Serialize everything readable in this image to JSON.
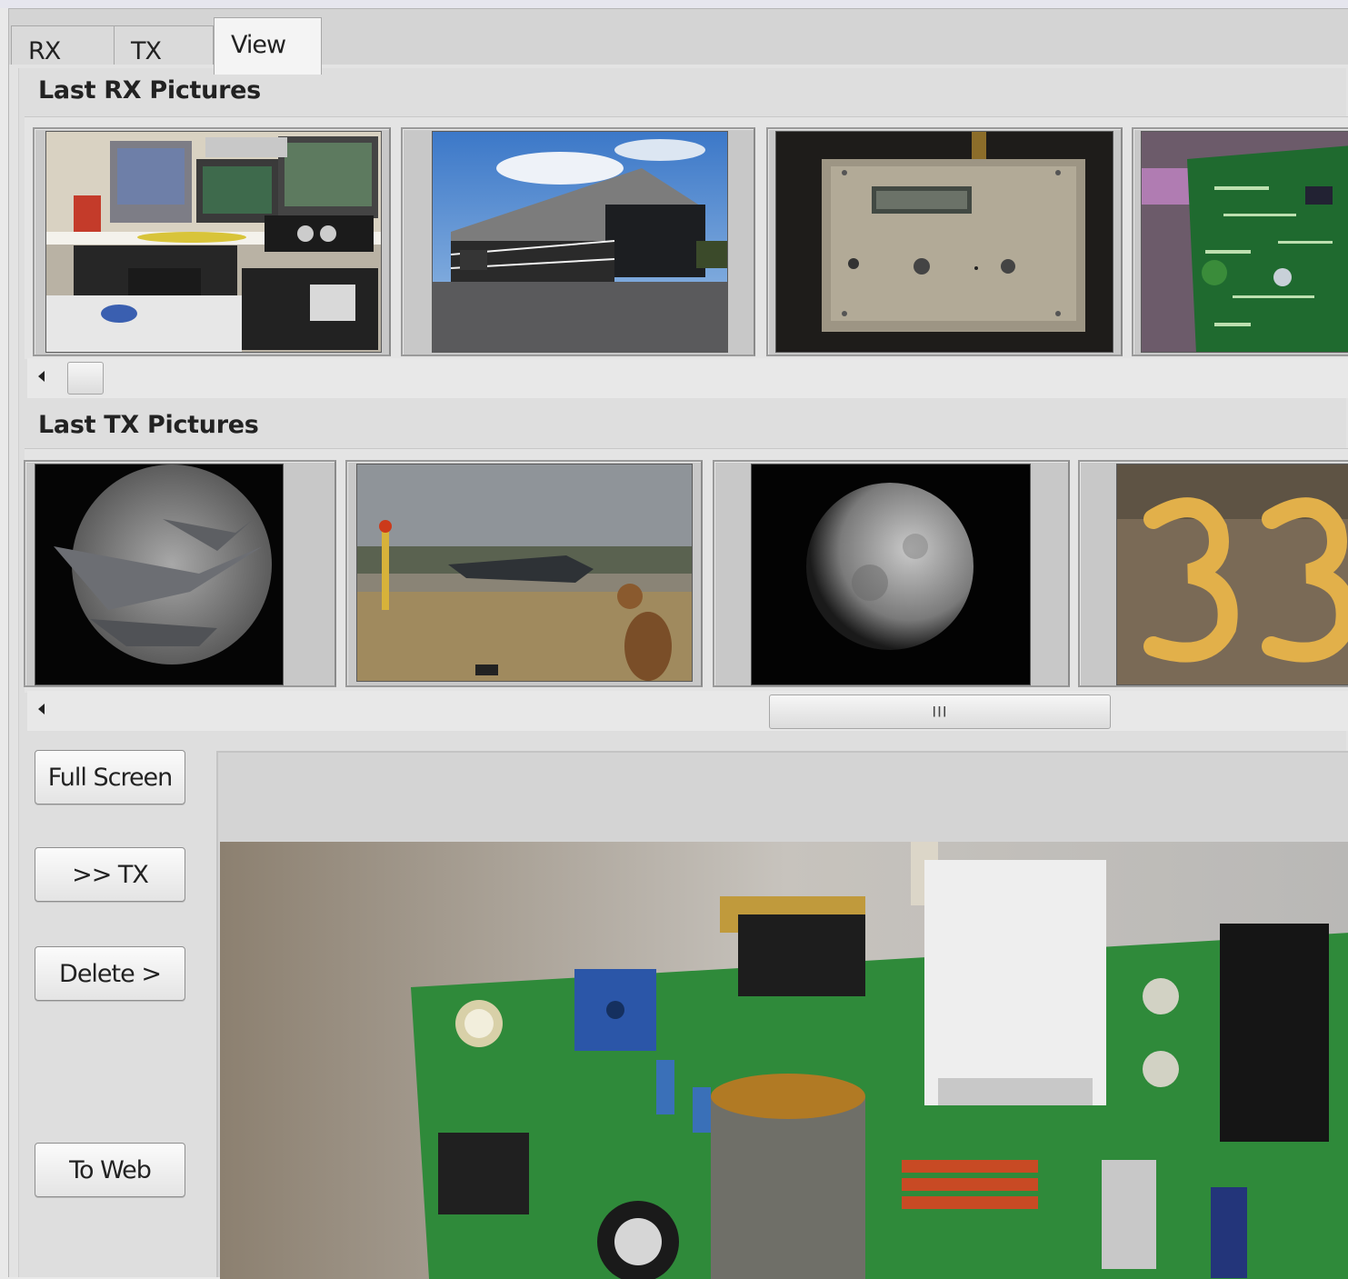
{
  "tabs": [
    {
      "label": "RX",
      "active": false
    },
    {
      "label": "TX",
      "active": false
    },
    {
      "label": "View",
      "active": true
    }
  ],
  "rx_section": {
    "title": "Last RX Pictures",
    "pictures": [
      "rx-picture-radio-shack",
      "rx-picture-building",
      "rx-picture-enclosure",
      "rx-picture-circuit-board"
    ]
  },
  "tx_section": {
    "title": "Last TX Pictures",
    "pictures": [
      "tx-picture-jets-moon",
      "tx-picture-airfield-dog",
      "tx-picture-moon",
      "tx-picture-number-33"
    ]
  },
  "scrollbars": {
    "tx_grip": "III"
  },
  "buttons": {
    "full_screen": "Full Screen",
    "to_tx": ">> TX",
    "delete": "Delete >",
    "to_web": "To Web"
  },
  "colors": {
    "pcb_green": "#2f8a3a",
    "panel_gray": "#dedede"
  }
}
